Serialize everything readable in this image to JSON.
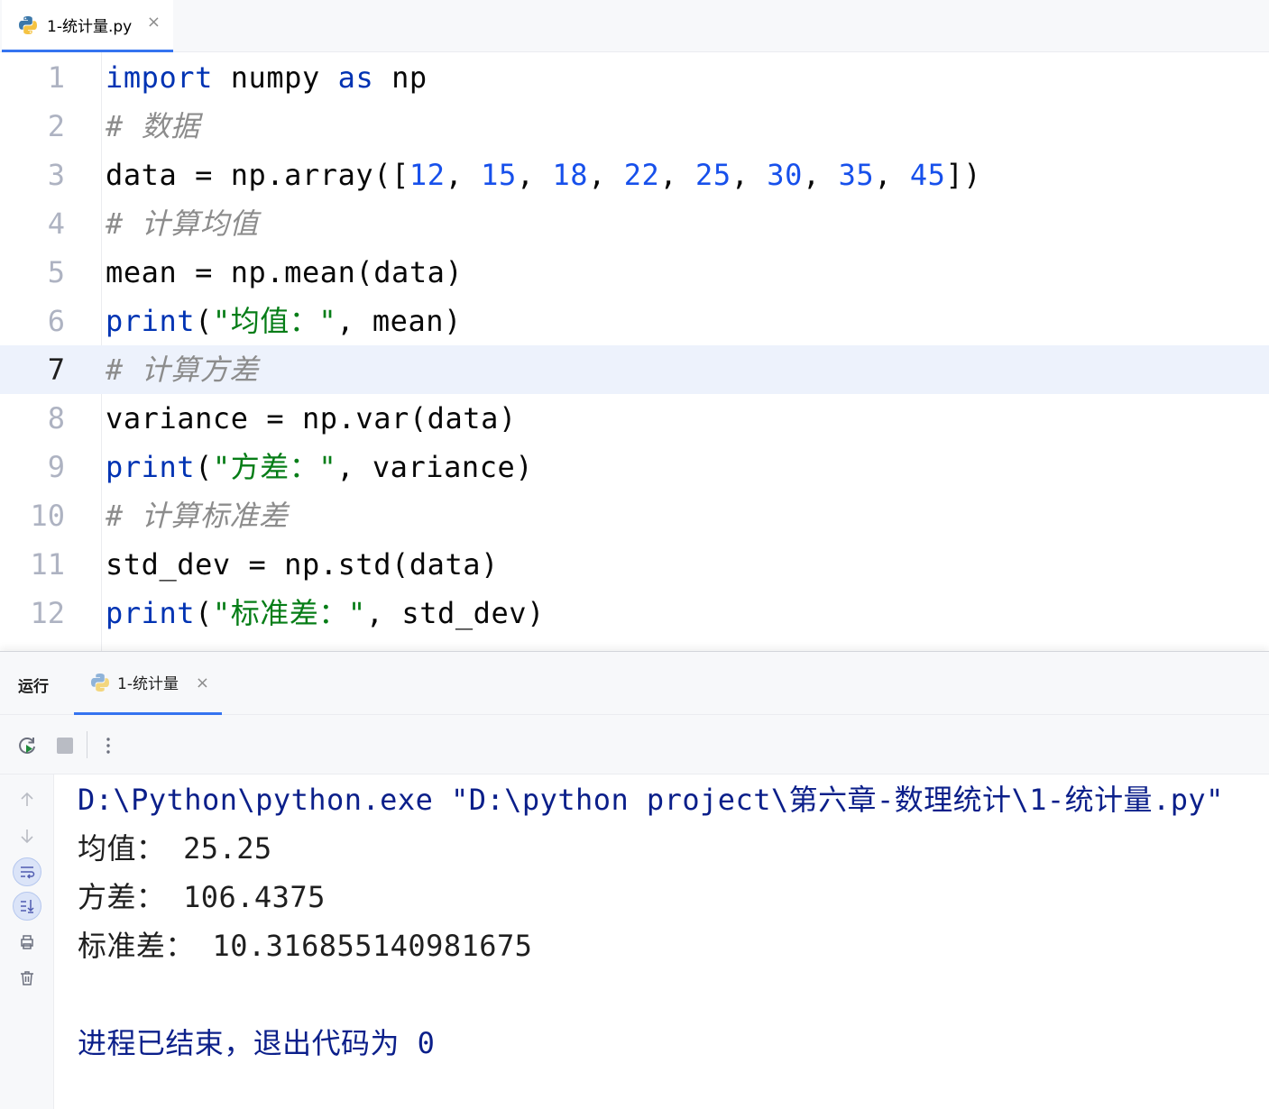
{
  "editor_tab": {
    "label": "1-统计量.py",
    "close": "×",
    "icon": "python-file-icon"
  },
  "code": {
    "lines": [
      {
        "n": "1",
        "t1": "import",
        "t2": " numpy ",
        "t3": "as",
        "t4": " np"
      },
      {
        "n": "2",
        "c": "# 数据"
      },
      {
        "n": "3",
        "pre": "data = np.array([",
        "nums": [
          "12",
          "15",
          "18",
          "22",
          "25",
          "30",
          "35",
          "45"
        ],
        "post": "])"
      },
      {
        "n": "4",
        "c": "# 计算均值"
      },
      {
        "n": "5",
        "plain": "mean = np.mean(data)"
      },
      {
        "n": "6",
        "kw": "print",
        "open": "(",
        "s": "\"均值：\"",
        "rest": ", mean)"
      },
      {
        "n": "7",
        "c": "# 计算方差"
      },
      {
        "n": "8",
        "plain": "variance = np.var(data)"
      },
      {
        "n": "9",
        "kw": "print",
        "open": "(",
        "s": "\"方差：\"",
        "rest": ", variance)"
      },
      {
        "n": "10",
        "c": "# 计算标准差"
      },
      {
        "n": "11",
        "plain": "std_dev = np.std(data)"
      },
      {
        "n": "12",
        "kw": "print",
        "open": "(",
        "s": "\"标准差：\"",
        "rest": ", std_dev)"
      }
    ],
    "current_line": "7"
  },
  "run_panel": {
    "title": "运行",
    "tab_label": "1-统计量",
    "tab_close": "×",
    "toolbar_icons": [
      "rerun-icon",
      "stop-icon",
      "more-options-icon"
    ],
    "side_icons": [
      "scroll-up-icon",
      "scroll-down-icon",
      "soft-wrap-icon",
      "scroll-to-end-icon",
      "print-icon",
      "trash-icon"
    ]
  },
  "console": {
    "command": "D:\\Python\\python.exe \"D:\\python project\\第六章-数理统计\\1-统计量.py\"",
    "out_mean": "均值： 25.25",
    "out_variance": "方差： 106.4375",
    "out_std": "标准差： 10.316855140981675",
    "exit": "进程已结束，退出代码为 0"
  },
  "colors": {
    "keyword": "#0033b3",
    "number": "#1750eb",
    "string": "#067d17",
    "comment": "#8c8c8c",
    "accent": "#3574f0",
    "console_sys": "#0b1f8a"
  }
}
